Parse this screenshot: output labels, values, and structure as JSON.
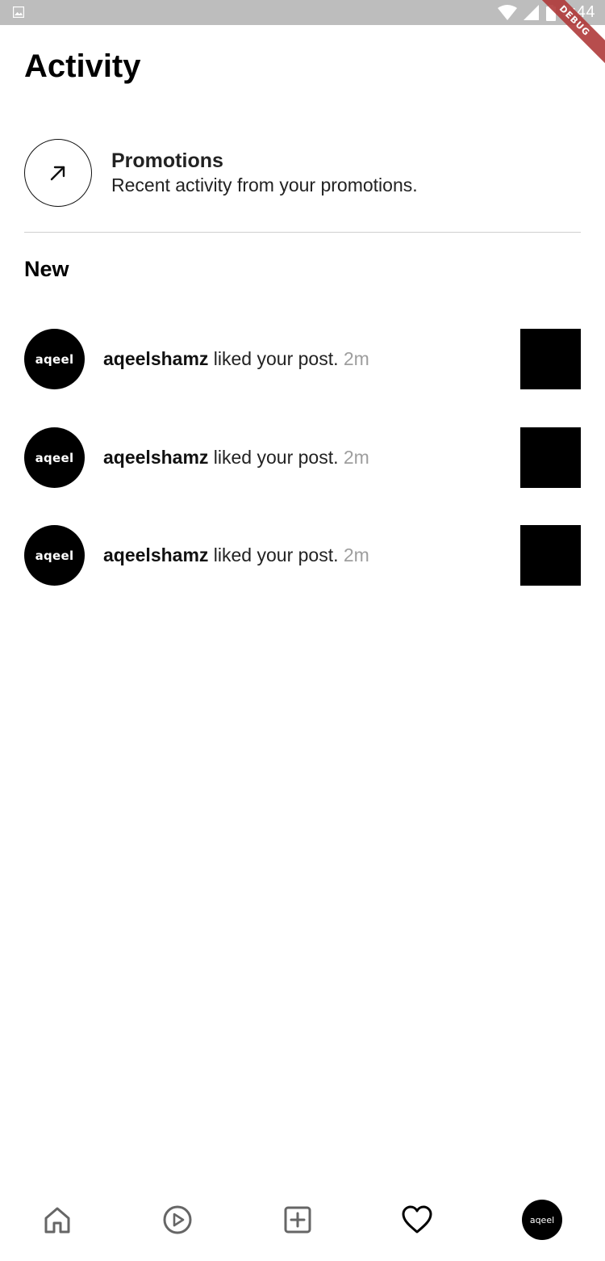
{
  "status_bar": {
    "time": "3:44",
    "debug_label": "DEBUG"
  },
  "header": {
    "title": "Activity"
  },
  "promotions": {
    "title": "Promotions",
    "subtitle": "Recent activity from your promotions.",
    "icon": "arrow-up-right-icon"
  },
  "section": {
    "heading": "New"
  },
  "activities": [
    {
      "avatar_text": "aqeel",
      "user": "aqeelshamz",
      "action": " liked your post. ",
      "time": "2m"
    },
    {
      "avatar_text": "aqeel",
      "user": "aqeelshamz",
      "action": " liked your post. ",
      "time": "2m"
    },
    {
      "avatar_text": "aqeel",
      "user": "aqeelshamz",
      "action": " liked your post. ",
      "time": "2m"
    }
  ],
  "bottom_nav": {
    "items": [
      {
        "icon": "home-icon"
      },
      {
        "icon": "play-circle-icon"
      },
      {
        "icon": "add-square-icon"
      },
      {
        "icon": "heart-icon",
        "active": true
      },
      {
        "icon": "profile-avatar",
        "avatar_text": "aqeel"
      }
    ]
  }
}
